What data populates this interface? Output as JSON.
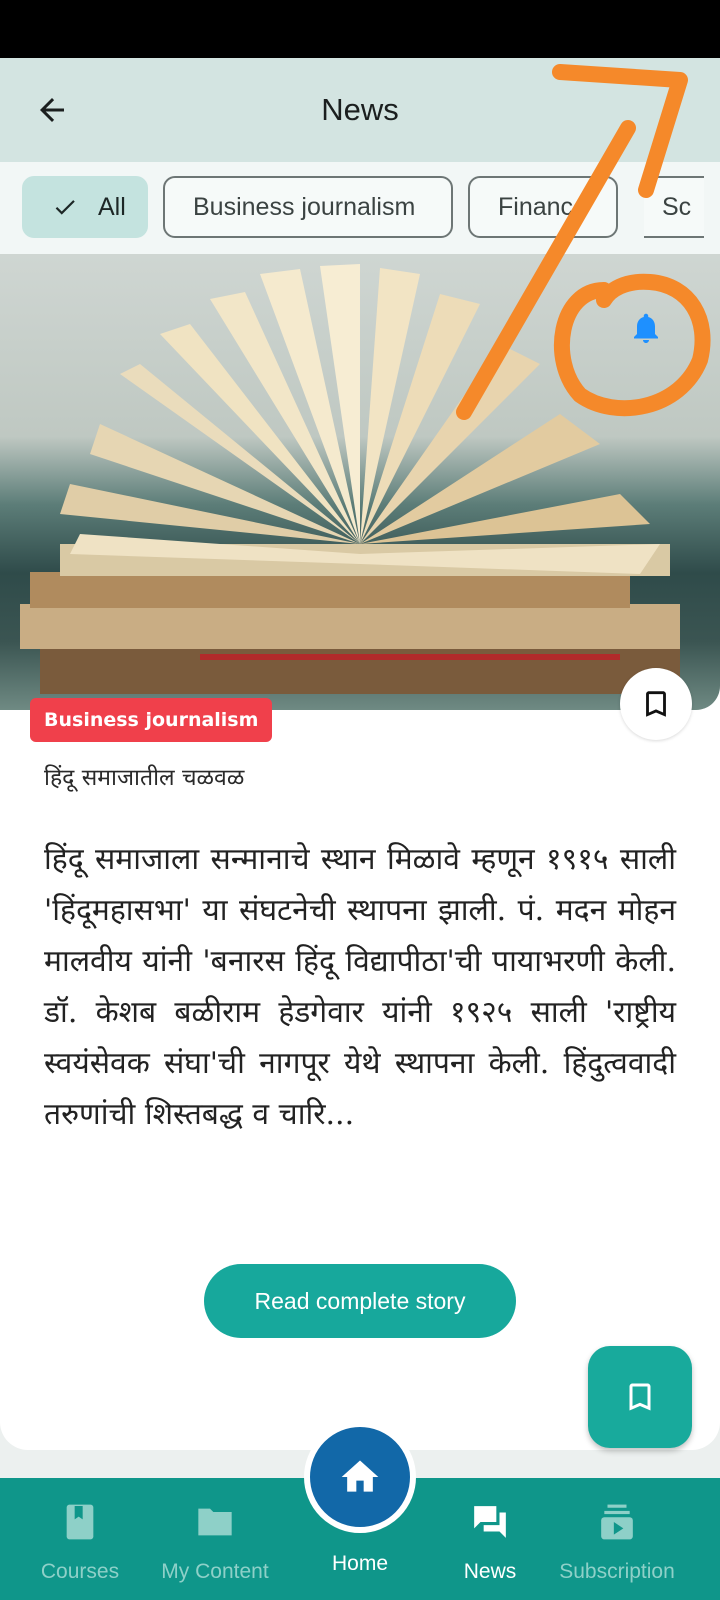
{
  "app_bar": {
    "title": "News"
  },
  "filters": [
    {
      "label": "All",
      "selected": true
    },
    {
      "label": "Business journalism",
      "selected": false
    },
    {
      "label": "Finance",
      "selected": false
    },
    {
      "label": "Sc",
      "selected": false
    }
  ],
  "article": {
    "category": "Business journalism",
    "subtitle": "हिंदू समाजातील चळवळ",
    "body": "हिंदू समाजाला सन्मानाचे स्थान मिळावे म्हणून १९१५ साली 'हिंदूमहासभा' या संघटनेची स्थापना झाली. पं. मदन मोहन मालवीय यांनी 'बनारस हिंदू विद्यापीठा'ची पायाभरणी केली. डॉ. केशब बळीराम हेडगेवार यांनी १९२५ साली 'राष्ट्रीय स्वयंसेवक संघा'ची नागपूर येथे स्थापना केली. हिंदुत्ववादी तरुणांची शिस्तबद्ध व चारि...",
    "read_button": "Read complete story"
  },
  "bottom_nav": {
    "courses": "Courses",
    "my_content": "My Content",
    "home": "Home",
    "news": "News",
    "subscription": "Subscription"
  },
  "colors": {
    "accent": "#17a89c",
    "nav_bg": "#0f968a",
    "home_button": "#1268a8",
    "badge": "#f0404b",
    "annotation": "#f5892a",
    "bell": "#1e90ff"
  },
  "icons": [
    "back-arrow-icon",
    "check-icon",
    "bell-icon",
    "bookmark-icon",
    "book-icon",
    "folder-icon",
    "home-icon",
    "chat-icon",
    "play-stack-icon"
  ]
}
